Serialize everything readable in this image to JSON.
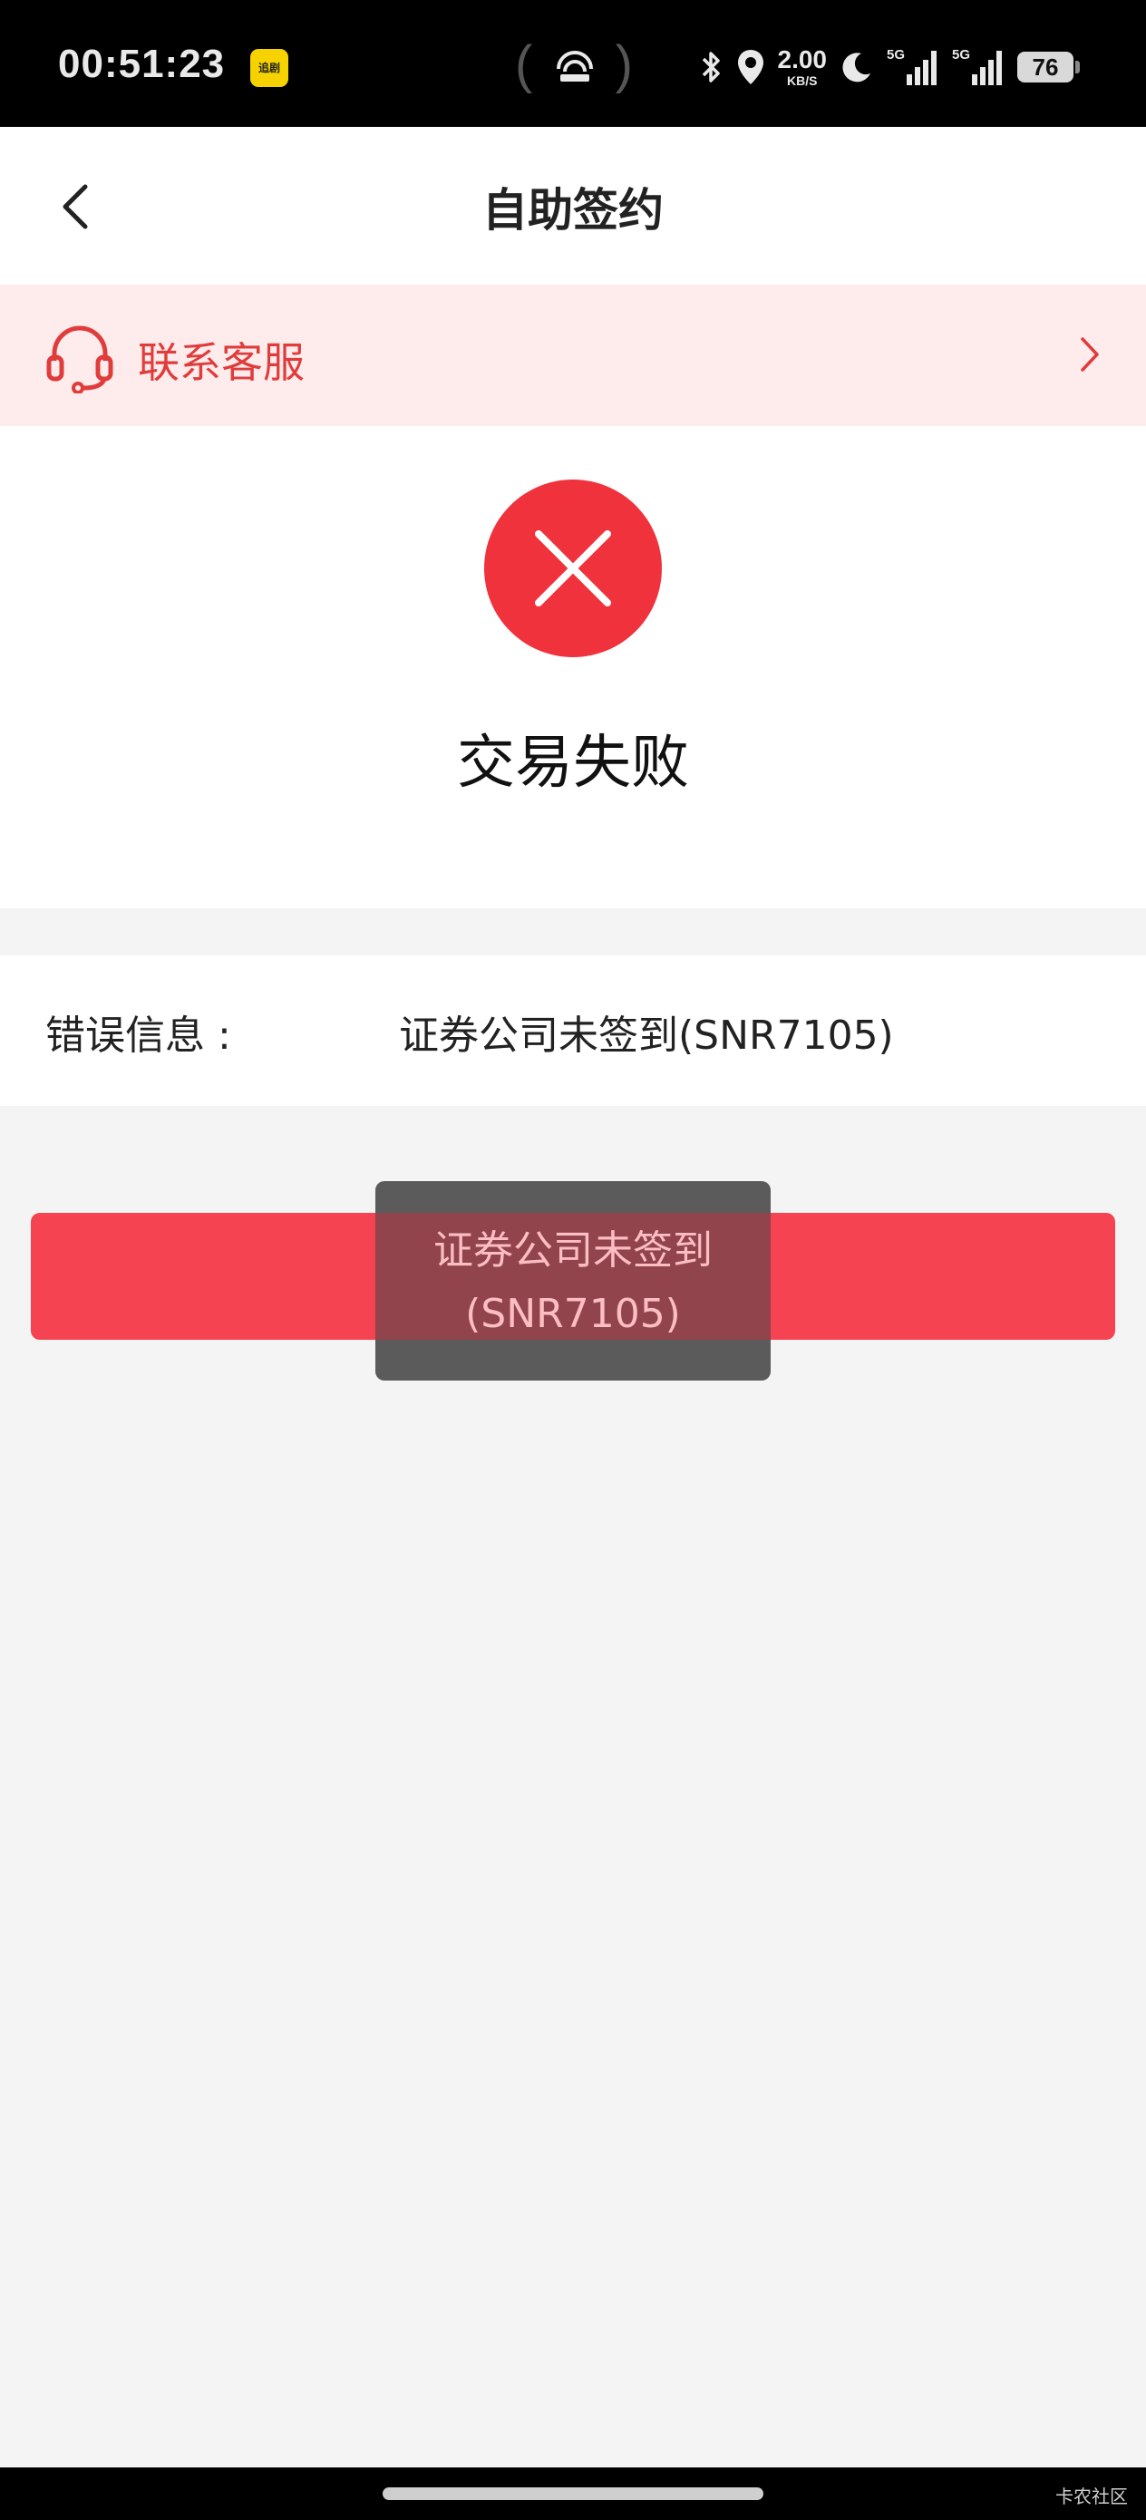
{
  "status_bar": {
    "time": "00:51:23",
    "app_badge_text": "追剧",
    "net_speed_value": "2.00",
    "net_speed_unit": "KB/S",
    "signal_1_label": "5G",
    "signal_2_label": "5G",
    "battery": "76"
  },
  "nav": {
    "title": "自助签约"
  },
  "contact": {
    "label": "联系客服"
  },
  "result": {
    "title": "交易失败"
  },
  "error": {
    "label": "错误信息 :",
    "value": "证券公司未签到(SNR7105)"
  },
  "toast": {
    "line1": "证券公司未签到",
    "line2": "(SNR7105)"
  },
  "footer": {
    "watermark": "卡农社区"
  },
  "colors": {
    "accent_red": "#f54352",
    "banner_bg": "#fdeceb",
    "fail_icon": "#f0323d"
  }
}
